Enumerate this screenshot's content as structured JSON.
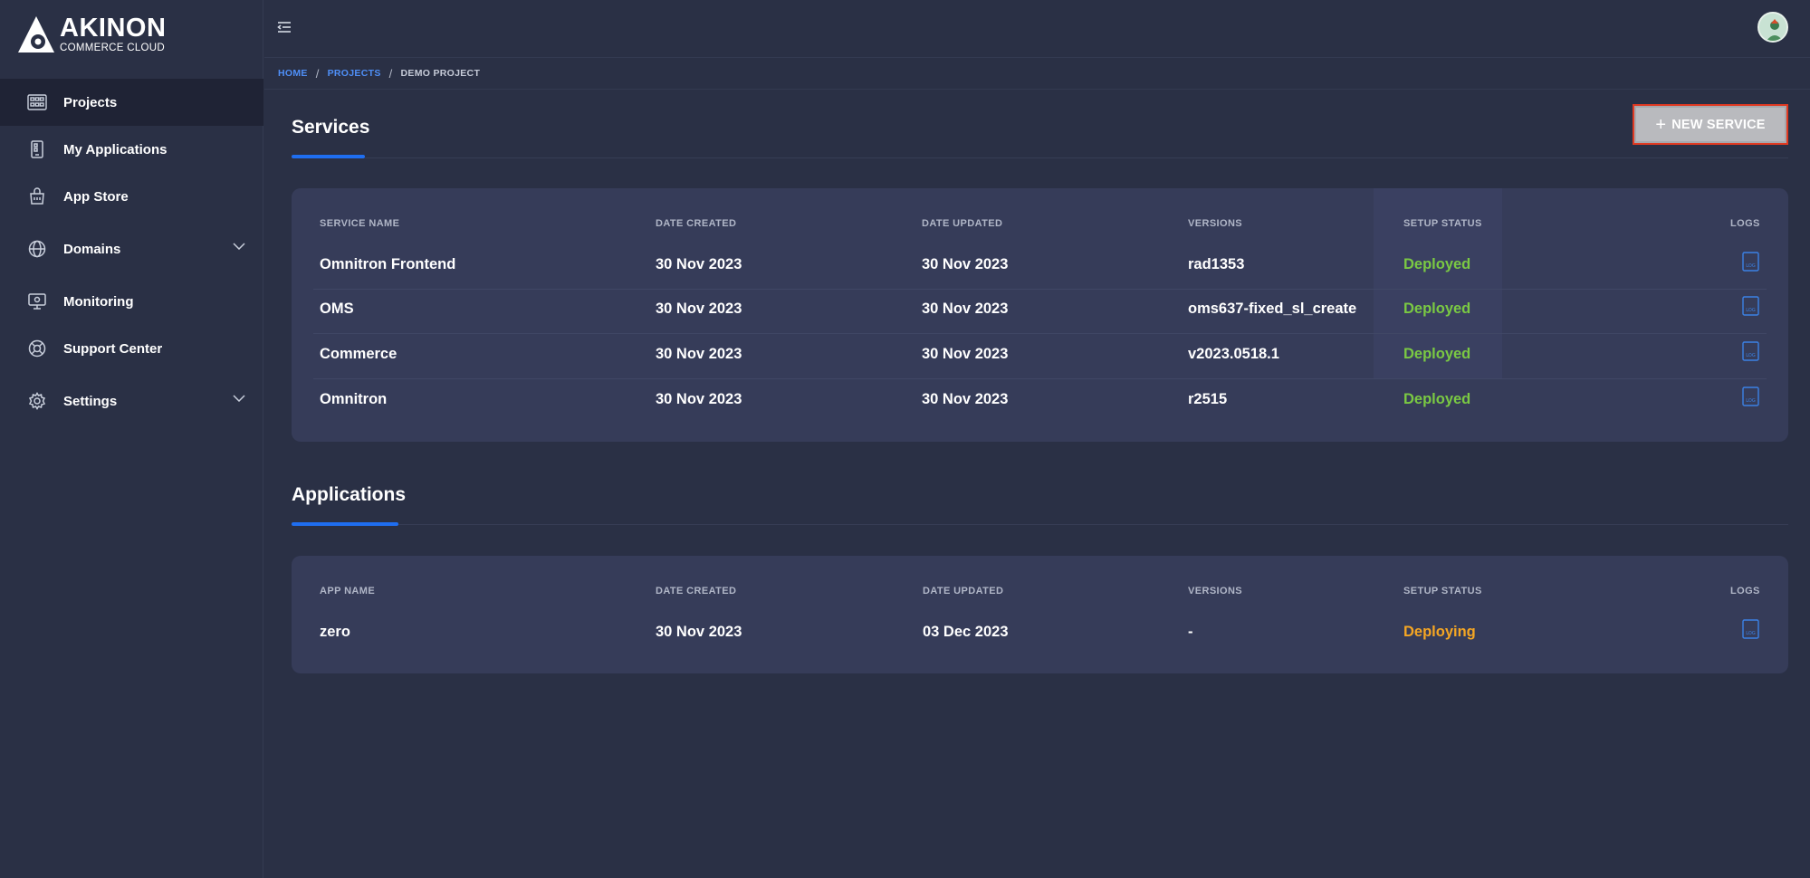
{
  "brand": {
    "name": "AKINON",
    "sub": "COMMERCE CLOUD"
  },
  "sidebar": {
    "items": [
      {
        "label": "Projects",
        "icon": "grid-icon",
        "active": true
      },
      {
        "label": "My Applications",
        "icon": "mobile-icon"
      },
      {
        "label": "App Store",
        "icon": "basket-icon"
      },
      {
        "label": "Domains",
        "icon": "globe-icon",
        "expandable": true
      },
      {
        "label": "Monitoring",
        "icon": "monitor-icon"
      },
      {
        "label": "Support Center",
        "icon": "lifebuoy-icon"
      },
      {
        "label": "Settings",
        "icon": "gear-icon",
        "expandable": true
      }
    ]
  },
  "breadcrumb": {
    "home": "HOME",
    "projects": "PROJECTS",
    "current": "DEMO PROJECT"
  },
  "services": {
    "title": "Services",
    "new_button": "NEW SERVICE",
    "headers": [
      "SERVICE NAME",
      "DATE CREATED",
      "DATE UPDATED",
      "VERSIONS",
      "SETUP STATUS",
      "LOGS"
    ],
    "rows": [
      {
        "name": "Omnitron Frontend",
        "created": "30 Nov 2023",
        "updated": "30 Nov 2023",
        "version": "rad1353",
        "status": "Deployed"
      },
      {
        "name": "OMS",
        "created": "30 Nov 2023",
        "updated": "30 Nov 2023",
        "version": "oms637-fixed_sl_create",
        "status": "Deployed"
      },
      {
        "name": "Commerce",
        "created": "30 Nov 2023",
        "updated": "30 Nov 2023",
        "version": "v2023.0518.1",
        "status": "Deployed"
      },
      {
        "name": "Omnitron",
        "created": "30 Nov 2023",
        "updated": "30 Nov 2023",
        "version": "r2515",
        "status": "Deployed"
      }
    ]
  },
  "applications": {
    "title": "Applications",
    "headers": [
      "APP NAME",
      "DATE CREATED",
      "DATE UPDATED",
      "VERSIONS",
      "SETUP STATUS",
      "LOGS"
    ],
    "rows": [
      {
        "name": "zero",
        "created": "30 Nov 2023",
        "updated": "03 Dec 2023",
        "version": "-",
        "status": "Deploying"
      }
    ]
  },
  "colors": {
    "background": "#2a3045",
    "card": "#363c59",
    "accent": "#1f6ef0",
    "deployed": "#7ac943",
    "deploying": "#f5a623",
    "link": "#4f8ff7"
  }
}
